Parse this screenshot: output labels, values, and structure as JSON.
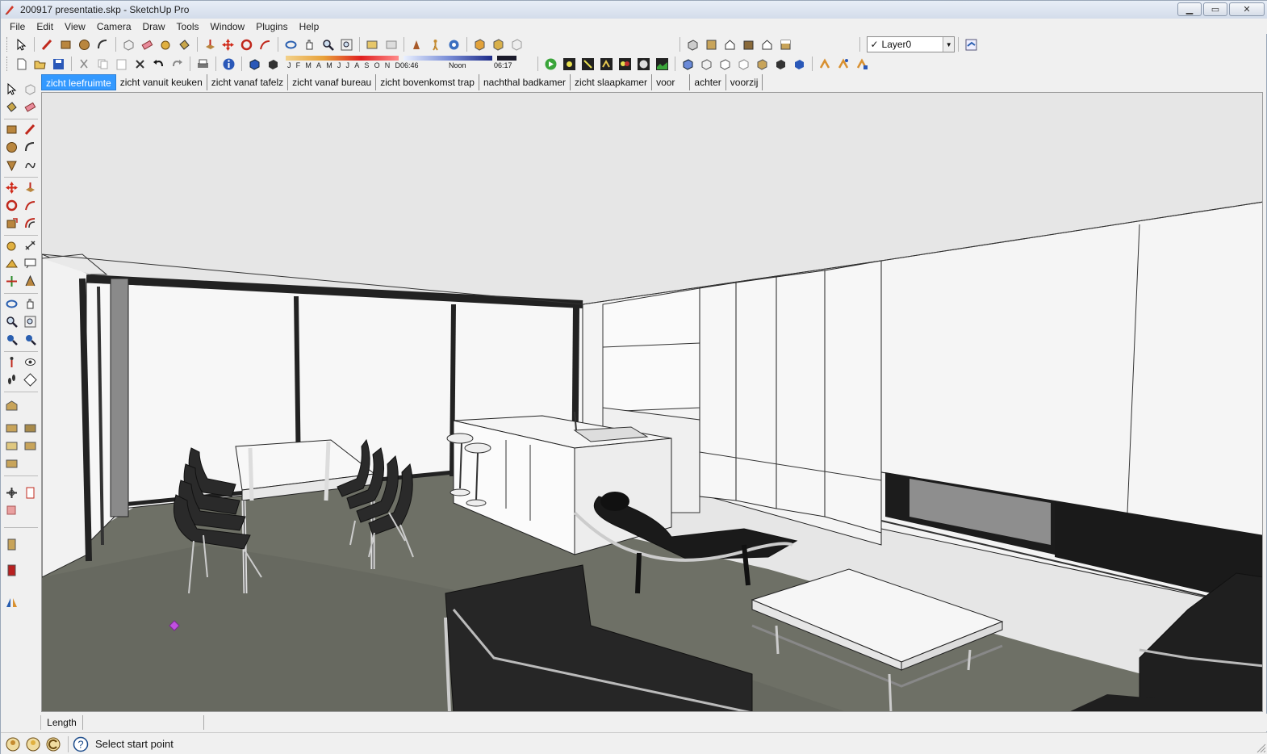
{
  "window": {
    "title": "200917 presentatie.skp - SketchUp Pro",
    "controls": {
      "minimize": "▁",
      "maximize": "▭",
      "close": "✕"
    }
  },
  "menu": [
    "File",
    "Edit",
    "View",
    "Camera",
    "Draw",
    "Tools",
    "Window",
    "Plugins",
    "Help"
  ],
  "shadow_settings": {
    "months": [
      "J",
      "F",
      "M",
      "A",
      "M",
      "J",
      "J",
      "A",
      "S",
      "O",
      "N",
      "D"
    ],
    "time_start": "06:46",
    "time_mid": "Noon",
    "time_end": "06:17"
  },
  "layer": {
    "checked": "✓",
    "current": "Layer0",
    "dropdown": "▼"
  },
  "scene_tabs": [
    {
      "label": "zicht leefruimte",
      "active": true
    },
    {
      "label": "zicht vanuit keuken",
      "active": false
    },
    {
      "label": "zicht vanaf tafelz",
      "active": false
    },
    {
      "label": "zicht vanaf bureau",
      "active": false
    },
    {
      "label": "zicht bovenkomst trap",
      "active": false
    },
    {
      "label": "nachthal badkamer",
      "active": false
    },
    {
      "label": "zicht slaapkamer",
      "active": false
    },
    {
      "label": "voor",
      "active": false
    },
    {
      "label": "achter",
      "active": false
    },
    {
      "label": "voorzij",
      "active": false
    }
  ],
  "measurements": {
    "label": "Length",
    "value": ""
  },
  "status": {
    "text": "Select start point"
  },
  "colors": {
    "active_tab": "#3399ff",
    "floor": "#6e7066",
    "walls": "#e8e8e8",
    "furniture_dark": "#262626"
  }
}
